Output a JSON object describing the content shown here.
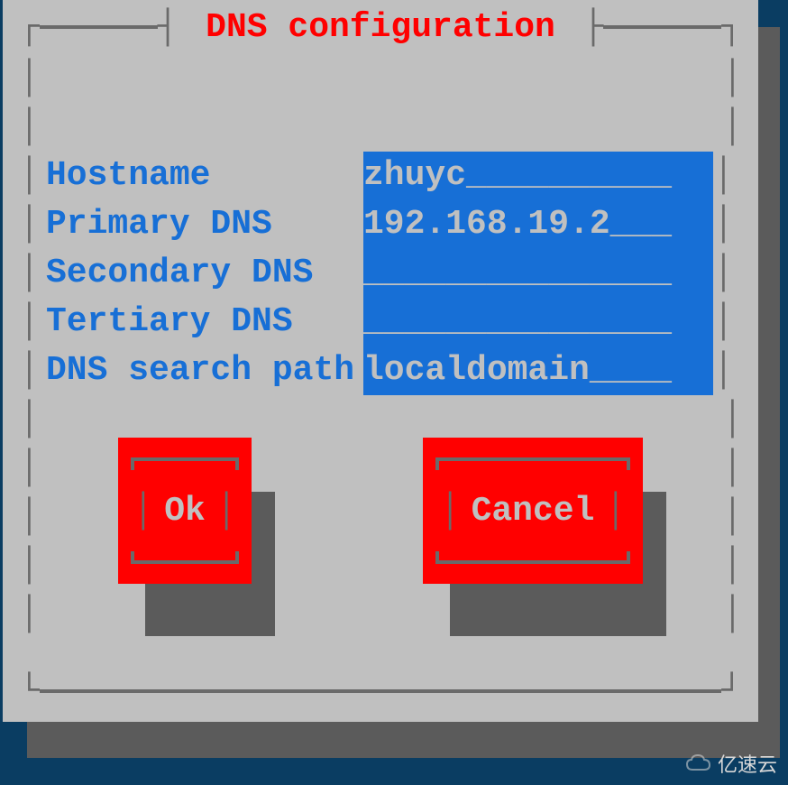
{
  "dialog": {
    "title": "DNS configuration"
  },
  "fields": [
    {
      "label": "Hostname",
      "value": "zhuyc__________"
    },
    {
      "label": "Primary DNS",
      "value": "192.168.19.2___"
    },
    {
      "label": "Secondary DNS",
      "value": "_______________"
    },
    {
      "label": "Tertiary DNS",
      "value": "_______________"
    },
    {
      "label": "DNS search path",
      "value": "localdomain____"
    }
  ],
  "buttons": {
    "ok": "Ok",
    "cancel": "Cancel"
  },
  "watermark": "亿速云"
}
